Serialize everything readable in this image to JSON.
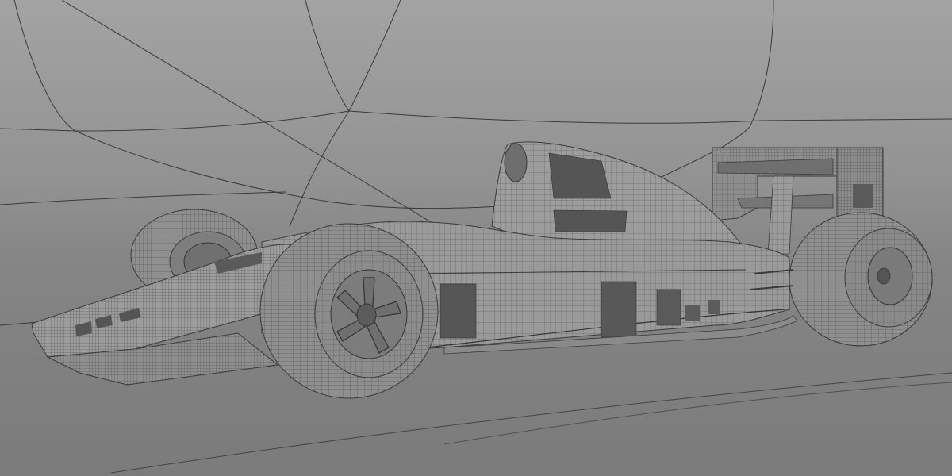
{
  "scene": {
    "subject": "formula-one-car-wireframe",
    "background_top_color": "#a2a2a2",
    "background_mid_color": "#8b8b8b",
    "floor_color": "#7a7a7a",
    "wire_color": "#3c3c3c",
    "body_fill": "#9a9a9a",
    "tire_fill": "#8e8e8e",
    "panel_fill": "#575757"
  }
}
